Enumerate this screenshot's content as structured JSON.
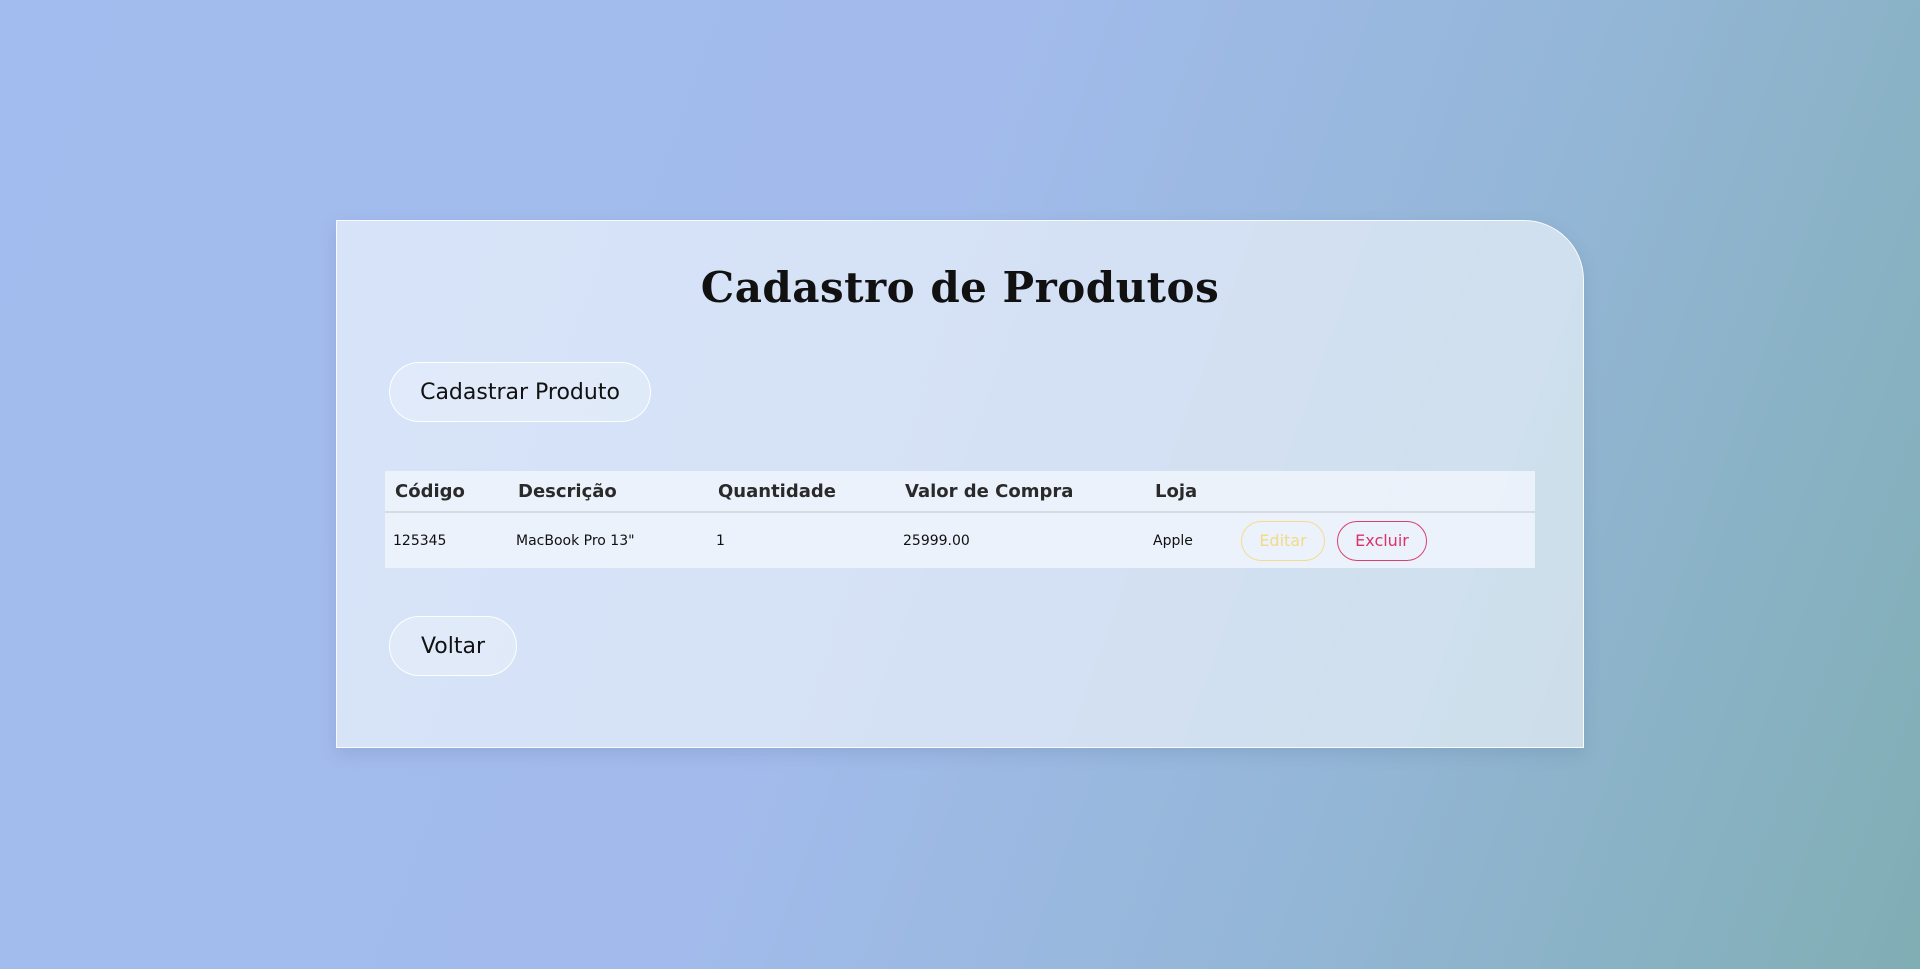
{
  "page": {
    "title": "Cadastro de Produtos"
  },
  "toolbar": {
    "register_label": "Cadastrar Produto",
    "back_label": "Voltar"
  },
  "table": {
    "headers": [
      "Código",
      "Descrição",
      "Quantidade",
      "Valor de Compra",
      "Loja"
    ],
    "rows": [
      {
        "codigo": "125345",
        "descricao": "MacBook Pro 13\"",
        "quantidade": "1",
        "valor_compra": "25999.00",
        "loja": "Apple",
        "edit_label": "Editar",
        "delete_label": "Excluir"
      }
    ]
  },
  "colors": {
    "edit_accent": "#f2da86",
    "delete_accent": "#d9346a"
  }
}
